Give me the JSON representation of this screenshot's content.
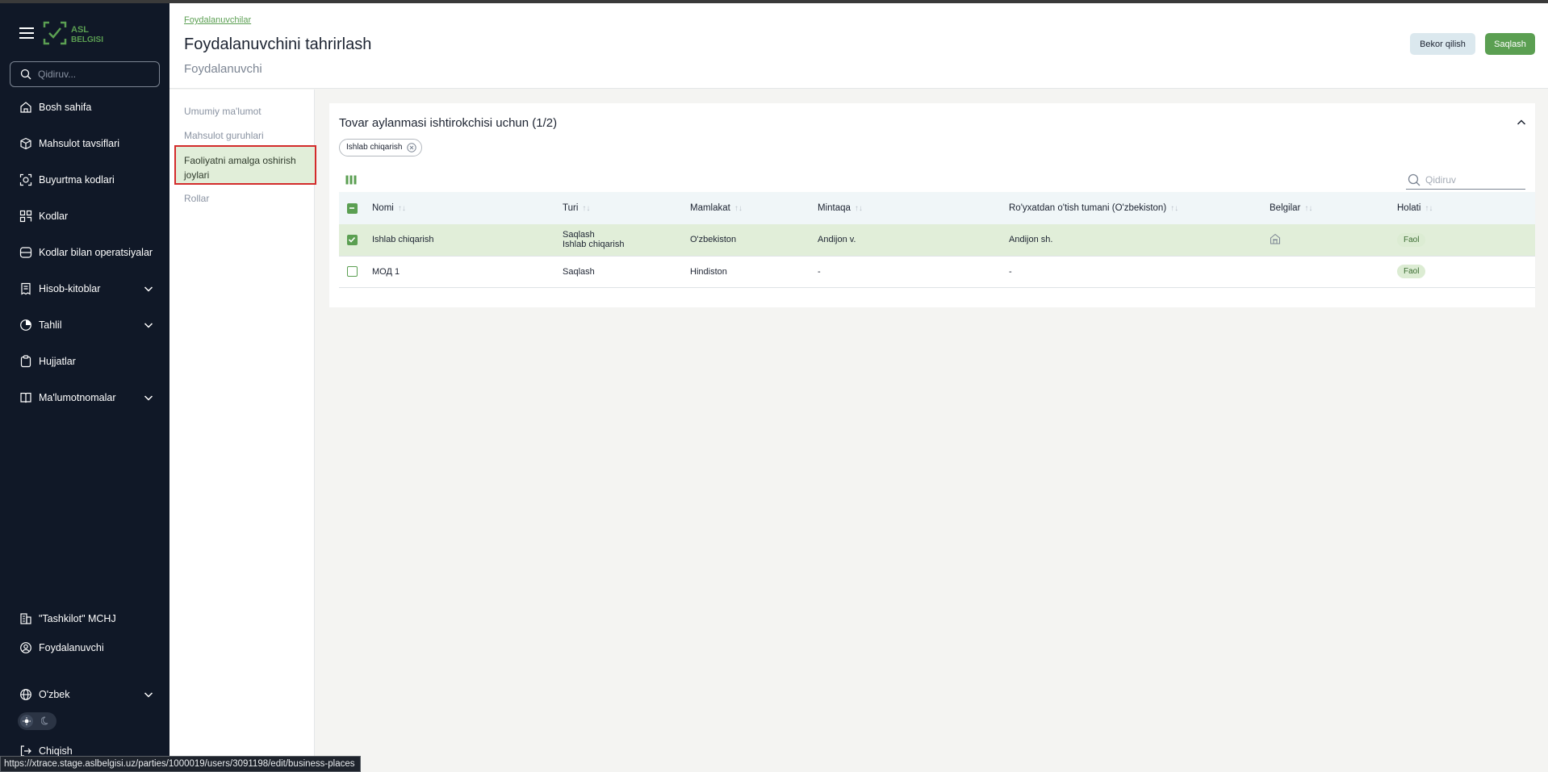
{
  "brand": {
    "logo_line1": "ASL",
    "logo_line2": "BELGISI"
  },
  "sidebar": {
    "search_placeholder": "Qidiruv...",
    "items": [
      {
        "label": "Bosh sahifa",
        "icon": "home-icon"
      },
      {
        "label": "Mahsulot tavsiflari",
        "icon": "box-icon"
      },
      {
        "label": "Buyurtma kodlari",
        "icon": "order-codes-icon"
      },
      {
        "label": "Kodlar",
        "icon": "codes-icon"
      },
      {
        "label": "Kodlar bilan operatsiyalar",
        "icon": "operations-icon"
      },
      {
        "label": "Hisob-kitoblar",
        "icon": "receipt-icon"
      },
      {
        "label": "Tahlil",
        "icon": "chart-icon"
      },
      {
        "label": "Hujjatlar",
        "icon": "clipboard-icon"
      },
      {
        "label": "Ma'lumotnomalar",
        "icon": "book-icon"
      }
    ],
    "organization": "\"Tashkilot\" MCHJ",
    "user": "Foydalanuvchi",
    "language": "O'zbek",
    "logout": "Chiqish"
  },
  "header": {
    "breadcrumb": "Foydalanuvchilar",
    "title": "Foydalanuvchini tahrirlash",
    "subtitle": "Foydalanuvchi",
    "cancel_label": "Bekor qilish",
    "save_label": "Saqlash"
  },
  "section_nav": {
    "items": [
      "Umumiy ma'lumot",
      "Mahsulot guruhlari",
      "Faoliyatni amalga oshirish joylari",
      "Rollar"
    ],
    "active_index": 2
  },
  "card": {
    "title": "Tovar aylanmasi ishtirokchisi uchun (1/2)",
    "filter_chip": "Ishlab chiqarish",
    "search_placeholder": "Qidiruv",
    "columns": [
      "Nomi",
      "Turi",
      "Mamlakat",
      "Mintaqa",
      "Ro'yxatdan o'tish tumani (O'zbekiston)",
      "Belgilar",
      "Holati"
    ],
    "rows": [
      {
        "selected": true,
        "name": "Ishlab chiqarish",
        "type1": "Saqlash",
        "type2": "Ishlab chiqarish",
        "country": "O'zbekiston",
        "region": "Andijon v.",
        "district": "Andijon sh.",
        "mark_icon": "building-icon",
        "status": "Faol"
      },
      {
        "selected": false,
        "name": "МОД 1",
        "type1": "Saqlash",
        "type2": "",
        "country": "Hindiston",
        "region": "-",
        "district": "-",
        "mark_icon": "",
        "status": "Faol"
      }
    ]
  },
  "status_url": "https://xtrace.stage.aslbelgisi.uz/parties/1000019/users/3091198/edit/business-places",
  "colors": {
    "sidebar_bg": "#101827",
    "accent_green": "#5b9f52",
    "selected_row": "#e1eed9",
    "active_outline": "#d32b2b"
  }
}
